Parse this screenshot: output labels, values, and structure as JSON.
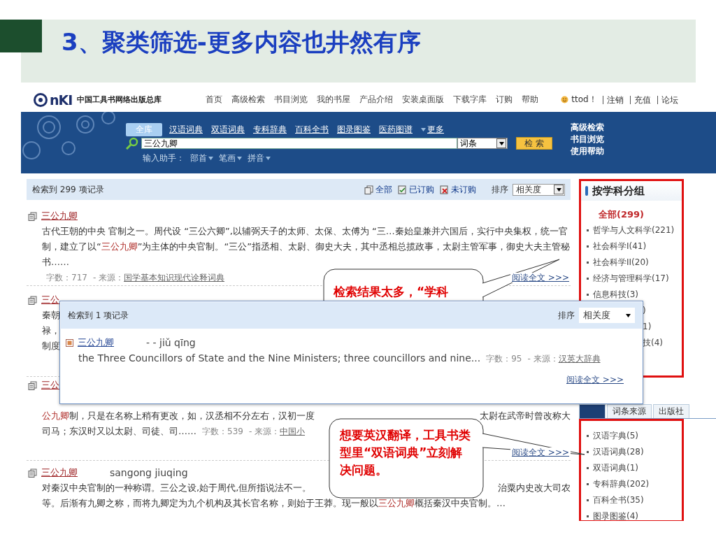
{
  "slide": {
    "title": "3、聚类筛选-更多内容也井然有序"
  },
  "site": {
    "logo": "nKI",
    "name": "中国工具书网络出版总库",
    "nav": [
      "首页",
      "高级检索",
      "书目浏览",
      "我的书屋",
      "产品介绍",
      "安装桌面版",
      "下载字库",
      "订购",
      "帮助"
    ],
    "user": "ttod！",
    "user_links": [
      "注销",
      "充值",
      "论坛"
    ]
  },
  "search": {
    "tabs": [
      {
        "label": "全库",
        "selected": true,
        "kind": "tab"
      },
      {
        "label": "汉语词典",
        "selected": false,
        "kind": "tab"
      },
      {
        "label": "双语词典",
        "selected": false,
        "kind": "tab"
      },
      {
        "label": "专科辞典",
        "selected": false,
        "kind": "tab"
      },
      {
        "label": "百科全书",
        "selected": false,
        "kind": "tab"
      },
      {
        "label": "图录图鉴",
        "selected": false,
        "kind": "tab"
      },
      {
        "label": "医药图谱",
        "selected": false,
        "kind": "tab"
      },
      {
        "label": "更多",
        "selected": false,
        "kind": "menu"
      }
    ],
    "query": "三公九卿",
    "field": "词条",
    "button": "检 索",
    "helper_label": "输入助手：",
    "helpers": [
      "部首",
      "笔画",
      "拼音"
    ],
    "side_links": [
      "高级检索",
      "书目浏览",
      "使用帮助"
    ]
  },
  "results": {
    "count": "检索到 299 项记录",
    "filters": [
      {
        "label": "全部",
        "kind": "all"
      },
      {
        "label": "已订购",
        "kind": "owned"
      },
      {
        "label": "未订购",
        "kind": "unowned"
      }
    ],
    "sort_label": "排序",
    "sort": "相关度",
    "items": [
      {
        "kind": "paragraph",
        "title": "三公九卿",
        "body": "古代王朝的中央 官制之一。周代设 “三公六卿”,以辅弼天子的太师、太保、太傅为 “三…秦始皇兼并六国后，实行中央集权，统一官制，建立了以“**三公九卿**”为主体的中央官制。“三公”指丞相、太尉、御史大夫，其中丞相总揽政事，太尉主管军事，御史大夫主管秘书……",
        "meta": {
          "count": "字数：717",
          "source_label": "- 来源：",
          "source": "国学基本知识现代诠释词典"
        },
        "more": "阅读全文 >>>"
      },
      {
        "kind": "edge",
        "title": "三公",
        "lines": [
          {
            "left": "秦朝"
          },
          {
            "left": "禄，"
          },
          {
            "left": "制度"
          }
        ]
      },
      {
        "kind": "tail",
        "title": "三公",
        "lines": [
          {
            "left": "**公九卿**制，只是在名称上稍有更改，如，汉丞相不分左右，汉初一度",
            "right": "太尉在武帝时曾改称大"
          },
          {
            "left": "司马；东汉时又以太尉、司徒、司……"
          }
        ],
        "meta": {
          "count": "字数：539",
          "source_label": "- 来源：",
          "source": "中国小"
        },
        "more": "阅读全文 >>>"
      },
      {
        "kind": "lines",
        "title": "三公九卿",
        "pinyin": "sangong jiuqing",
        "lines": [
          {
            "left": "对秦汉中央官制的一种称谓。三公之设,始于周代,但所指说法不一。",
            "right": "治粟内史改大司农"
          },
          {
            "left": "等。后渐有九卿之称，而将九卿定为九个机构及其长官名称，则始于王莽。现一般以**三公九卿**概括秦汉中央官制。…"
          }
        ]
      }
    ]
  },
  "popup": {
    "count": "检索到 1 项记录",
    "sort_label": "排序",
    "sort": "相关度",
    "title": "三公九卿",
    "pinyin": "- - jiǔ qīng",
    "body": "the Three Councillors of State and the Nine Ministers; three councillors and nine...",
    "meta": {
      "count": "字数：95",
      "source_label": "- 来源：",
      "source": "汉英大辞典"
    },
    "more": "阅读全文 >>>"
  },
  "callouts": [
    {
      "text": "检索结果太多，“学科"
    },
    {
      "text": "想要英汉翻译，工具书类型里“双语词典”立刻解决问题。"
    }
  ],
  "sidebar": {
    "heading": "按学科分组",
    "subjects": [
      {
        "label": "全部(299)",
        "selected": true,
        "kind": "item"
      },
      {
        "label": "哲学与人文科学(221)",
        "selected": false,
        "kind": "item"
      },
      {
        "label": "社会科学I(41)",
        "selected": false,
        "kind": "item"
      },
      {
        "label": "社会科学II(20)",
        "selected": false,
        "kind": "item"
      },
      {
        "label": "经济与管理科学(17)",
        "selected": false,
        "kind": "item"
      },
      {
        "label": "信息科技(3)",
        "selected": false,
        "kind": "item"
      },
      {
        "label": ")",
        "selected": false,
        "kind": "partial"
      },
      {
        "label": "1)",
        "selected": false,
        "kind": "partial"
      },
      {
        "label": "技(4)",
        "selected": false,
        "kind": "partial"
      }
    ],
    "tabs": [
      {
        "selected": true
      },
      {
        "label": "词条来源",
        "selected": false
      },
      {
        "label": "出版社",
        "selected": false
      }
    ],
    "types": [
      {
        "label": "汉语字典(5)",
        "selected": false
      },
      {
        "label": "汉语词典(28)",
        "selected": false
      },
      {
        "label": "双语词典(1)",
        "selected": false
      },
      {
        "label": "专科辞典(202)",
        "selected": false
      },
      {
        "label": "百科全书(35)",
        "selected": false
      },
      {
        "label": "图录图鉴(4)",
        "selected": false
      }
    ]
  }
}
